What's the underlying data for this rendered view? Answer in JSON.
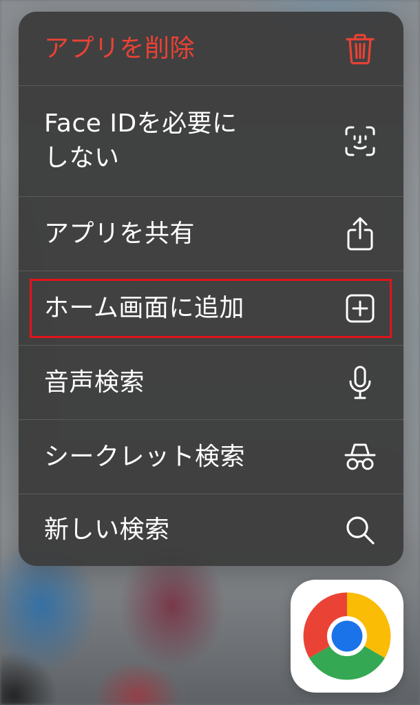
{
  "menu": {
    "items": [
      {
        "label": "アプリを削除",
        "icon": "trash-icon",
        "style": "destructive"
      },
      {
        "label": "Face IDを必要に\nしない",
        "icon": "face-id-icon",
        "style": "default"
      },
      {
        "label": "アプリを共有",
        "icon": "share-icon",
        "style": "default"
      },
      {
        "label": "ホーム画面に追加",
        "icon": "add-square-icon",
        "style": "default"
      },
      {
        "label": "音声検索",
        "icon": "microphone-icon",
        "style": "default"
      },
      {
        "label": "シークレット検索",
        "icon": "incognito-icon",
        "style": "default"
      },
      {
        "label": "新しい検索",
        "icon": "search-icon",
        "style": "default"
      }
    ]
  },
  "highlighted_item": "ホーム画面に追加",
  "app": {
    "icon": "chrome-app-icon"
  },
  "colors": {
    "destructive": "#ea4235",
    "menu_text": "#ffffff",
    "highlight_border": "#e2131a",
    "menu_background": "#3a3a3a"
  }
}
